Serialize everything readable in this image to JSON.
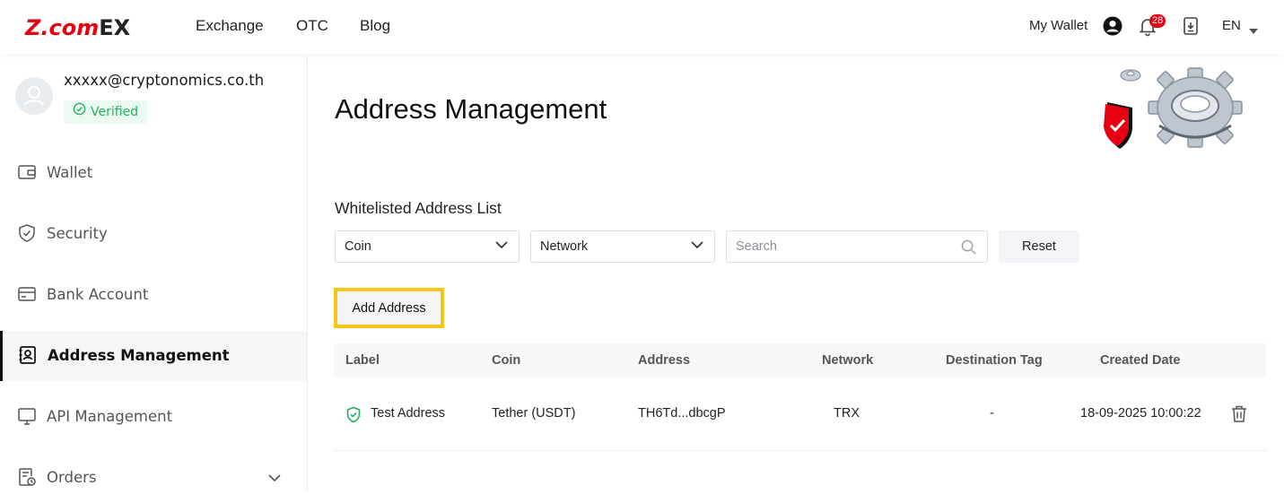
{
  "header": {
    "logo": {
      "part1": "Z.com",
      "part2": "EX"
    },
    "nav": [
      {
        "label": "Exchange"
      },
      {
        "label": "OTC"
      },
      {
        "label": "Blog"
      }
    ],
    "my_wallet": "My Wallet",
    "notification_count": "28",
    "language": "EN"
  },
  "sidebar": {
    "email": "xxxxx@cryptonomics.co.th",
    "verified": "Verified",
    "items": [
      {
        "label": "Wallet",
        "icon": "wallet-icon"
      },
      {
        "label": "Security",
        "icon": "shield-icon"
      },
      {
        "label": "Bank Account",
        "icon": "card-icon"
      },
      {
        "label": "Address Management",
        "icon": "address-book-icon",
        "active": true
      },
      {
        "label": "API Management",
        "icon": "monitor-icon"
      },
      {
        "label": "Orders",
        "icon": "orders-icon"
      }
    ]
  },
  "main": {
    "title": "Address Management",
    "section_title": "Whitelisted Address List",
    "filters": {
      "coin": "Coin",
      "network": "Network",
      "search_placeholder": "Search",
      "reset": "Reset"
    },
    "add_address": "Add Address",
    "table": {
      "headers": [
        "Label",
        "Coin",
        "Address",
        "Network",
        "Destination Tag",
        "Created Date"
      ],
      "rows": [
        {
          "label": "Test Address",
          "coin": "Tether (USDT)",
          "address": "TH6Td...dbcgP",
          "network": "TRX",
          "tag": "-",
          "created": "18-09-2025 10:00:22"
        }
      ]
    }
  },
  "colors": {
    "brand_red": "#e60012",
    "highlight": "#f5c518",
    "verified_green": "#27ae60"
  }
}
